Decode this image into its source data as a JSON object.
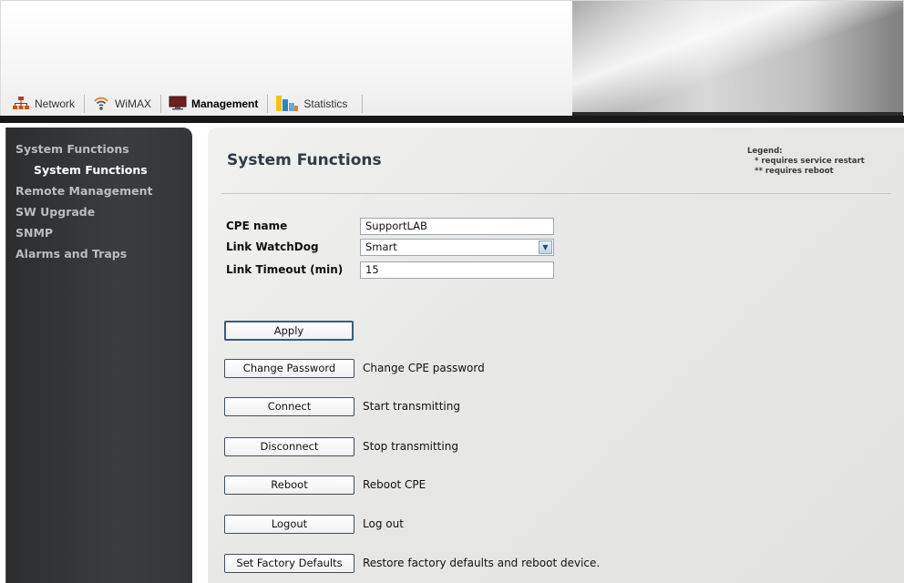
{
  "tabs": [
    {
      "label": "Network",
      "icon": "network-icon"
    },
    {
      "label": "WiMAX",
      "icon": "wireless-icon"
    },
    {
      "label": "Management",
      "icon": "monitor-icon",
      "active": true
    },
    {
      "label": "Statistics",
      "icon": "bar-chart-icon"
    }
  ],
  "sidebar": {
    "items": [
      {
        "label": "System Functions"
      },
      {
        "label": "System Functions",
        "selected": true
      },
      {
        "label": "Remote Management"
      },
      {
        "label": "SW Upgrade"
      },
      {
        "label": "SNMP"
      },
      {
        "label": "Alarms and Traps"
      }
    ]
  },
  "main": {
    "title": "System Functions",
    "legend": {
      "heading": "Legend:",
      "row1_mark": "*",
      "row1_text": "requires service restart",
      "row2_mark": "**",
      "row2_text": "requires reboot"
    },
    "fields": {
      "cpe_name_label": "CPE name",
      "cpe_name_value": "SupportLAB",
      "watchdog_label": "Link WatchDog",
      "watchdog_value": "Smart",
      "timeout_label": "Link Timeout (min)",
      "timeout_value": "15"
    },
    "buttons": {
      "apply": "Apply",
      "change_password": "Change Password",
      "change_password_desc": "Change CPE password",
      "connect": "Connect",
      "connect_desc": "Start transmitting",
      "disconnect": "Disconnect",
      "disconnect_desc": "Stop transmitting",
      "reboot": "Reboot",
      "reboot_desc": "Reboot CPE",
      "logout": "Logout",
      "logout_desc": "Log out",
      "factory": "Set Factory Defaults",
      "factory_desc": "Restore factory defaults and reboot device."
    }
  },
  "colors": {
    "sidebar_bg": "#2b2d2f",
    "title_color": "#2f3b46",
    "button_border": "#3f4f60"
  }
}
